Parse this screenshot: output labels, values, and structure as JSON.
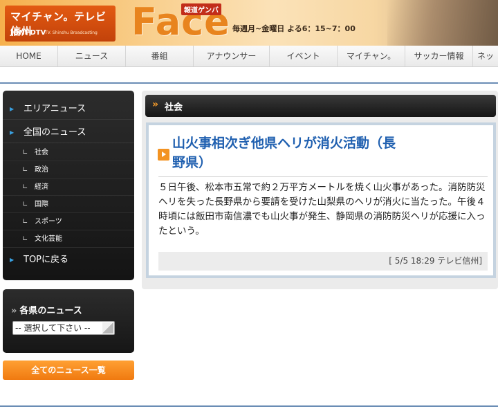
{
  "banner": {
    "station_name": "マイチャン。テレビ信州",
    "station_code": "JONI-DTV",
    "station_en": "TV. Shinshu Broadcasting",
    "program_badge": "報道ゲンバ",
    "program_title": "Face",
    "schedule": "毎週月~金曜日 よる6：15~7：00"
  },
  "nav": {
    "items": [
      "HOME",
      "ニュース",
      "番組",
      "アナウンサー",
      "イベント",
      "マイチャン。",
      "サッカー情報",
      "ネッ"
    ]
  },
  "sidebar": {
    "area_news": "エリアニュース",
    "national_news": "全国のニュース",
    "categories": [
      "社会",
      "政治",
      "経済",
      "国際",
      "スポーツ",
      "文化芸能"
    ],
    "back_to_top": "TOPに戻る",
    "prefecture_title": "各県のニュース",
    "prefecture_select": "-- 選択して下さい --",
    "all_news_button": "全てのニュース一覧"
  },
  "section": {
    "title": "社会"
  },
  "article": {
    "headline": "山火事相次ぎ他県ヘリが消火活動（長野県）",
    "body": "５日午後、松本市五常で約２万平方メートルを焼く山火事があった。消防防災ヘリを失った長野県から要請を受けた山梨県のヘリが消火に当たった。午後４時頃には飯田市南信濃でも山火事が発生、静岡県の消防防災ヘリが応援に入ったという。",
    "dateline": "[ 5/5 18:29 テレビ信州]"
  },
  "colors": {
    "accent_orange": "#f39322",
    "headline_blue": "#2060b0",
    "rule_blue": "#6a8db5"
  }
}
